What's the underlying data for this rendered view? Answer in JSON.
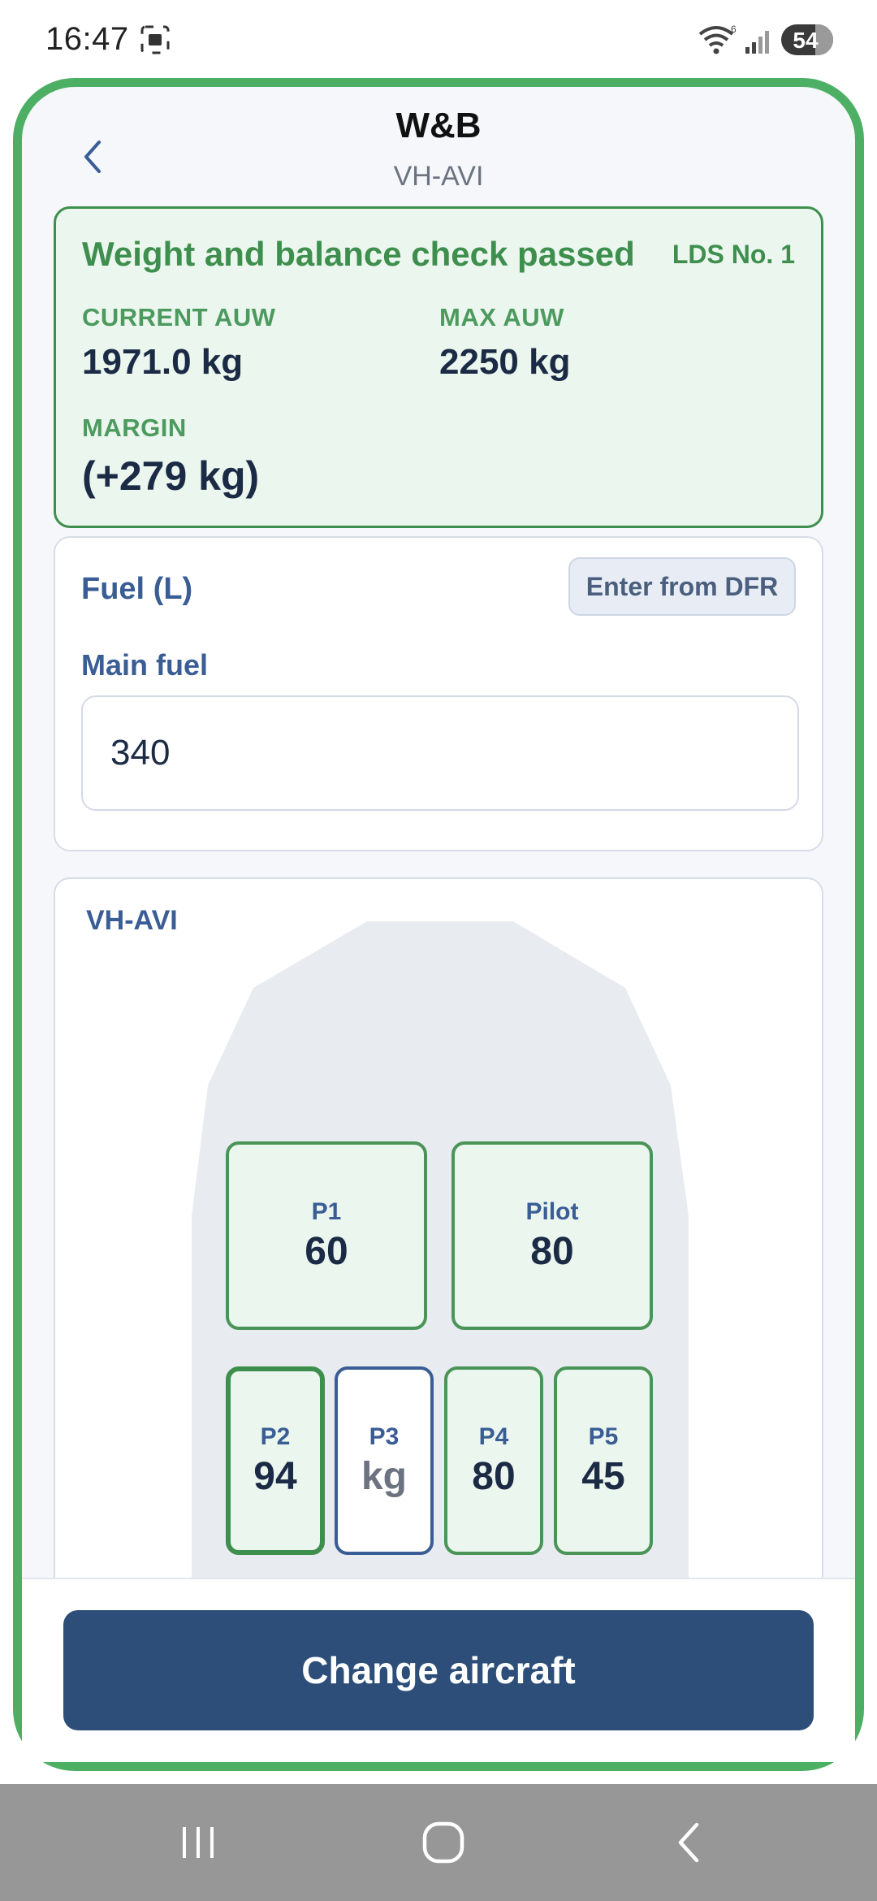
{
  "status_bar": {
    "time": "16:47",
    "battery": "54",
    "icons": [
      "screenshot-icon",
      "wifi-icon",
      "signal-icon",
      "battery-icon"
    ]
  },
  "header": {
    "title": "W&B",
    "subtitle": "VH-AVI"
  },
  "check": {
    "title": "Weight and balance check passed",
    "lds": "LDS No. 1",
    "current_auw_label": "CURRENT AUW",
    "current_auw_value": "1971.0 kg",
    "max_auw_label": "MAX AUW",
    "max_auw_value": "2250 kg",
    "margin_label": "MARGIN",
    "margin_value": "(+279 kg)",
    "colors": {
      "accent": "#3e8f4e",
      "background": "#ebf6ee"
    }
  },
  "fuel": {
    "title": "Fuel (L)",
    "dfr_button": "Enter from DFR",
    "main_fuel_label": "Main fuel",
    "main_fuel_value": "340"
  },
  "aircraft": {
    "label": "VH-AVI",
    "seats": [
      {
        "name": "P1",
        "value": "60"
      },
      {
        "name": "Pilot",
        "value": "80"
      },
      {
        "name": "P2",
        "value": "94"
      },
      {
        "name": "P3",
        "value": "kg"
      },
      {
        "name": "P4",
        "value": "80"
      },
      {
        "name": "P5",
        "value": "45"
      }
    ]
  },
  "footer": {
    "change_aircraft": "Change aircraft"
  },
  "colors": {
    "frame": "#4caf63",
    "primary": "#2c4e78",
    "label_blue": "#3a5d95"
  }
}
